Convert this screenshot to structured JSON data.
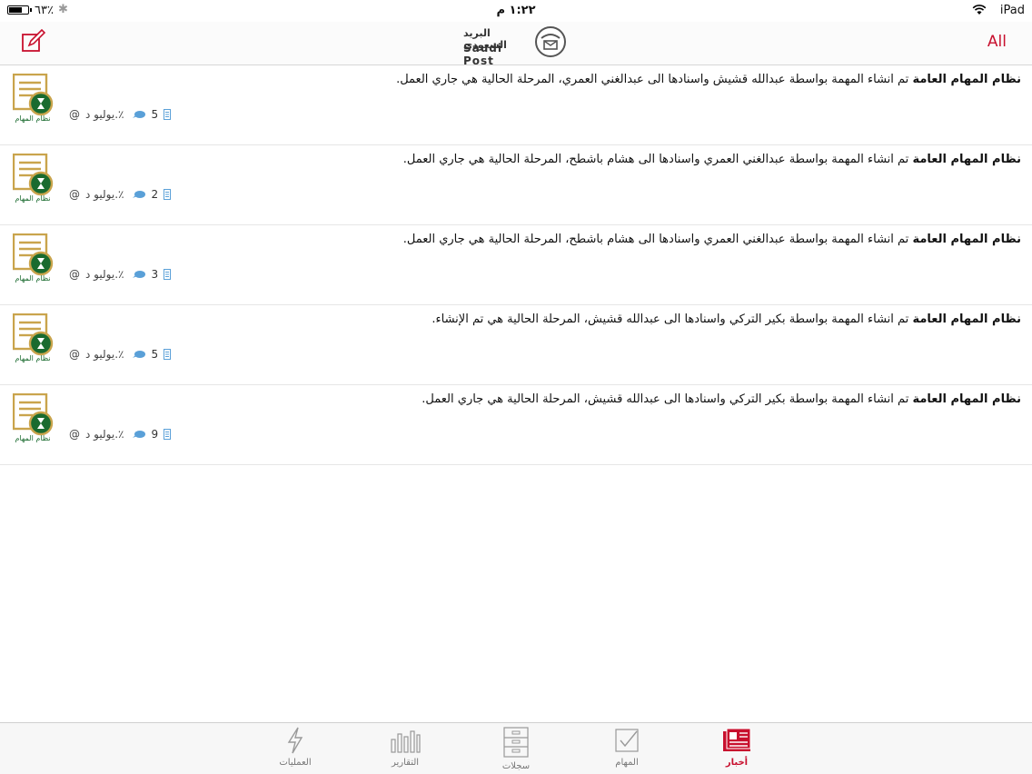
{
  "status": {
    "battery": "٦٣٪",
    "time": "١:٢٢ م",
    "device": "iPad"
  },
  "nav": {
    "all_label": "All",
    "logo_ar": "البريد السعودي",
    "logo_en": "Saudi Post"
  },
  "colors": {
    "accent": "#c8102e",
    "green": "#1a6b2f",
    "gold": "#c9a44c",
    "bubble": "#5aa0d8",
    "tag": "#5aa0d8"
  },
  "items": [
    {
      "system": "نظام المهام العامة",
      "text": "تم انشاء المهمة بواسطة عبدالله قشيش واسنادها الى عبدالغني العمري، المرحلة الحالية هي  جاري العمل.",
      "avatar_caption": "نظام المهام",
      "comments": "5",
      "date": "يوليو د.٪",
      "at": "@"
    },
    {
      "system": "نظام المهام العامة",
      "text": "تم انشاء المهمة بواسطة عبدالغني العمري واسنادها الى هشام باشطح، المرحلة الحالية هي  جاري العمل.",
      "avatar_caption": "نظام المهام",
      "comments": "2",
      "date": "يوليو د.٪",
      "at": "@"
    },
    {
      "system": "نظام المهام العامة",
      "text": "تم انشاء المهمة بواسطة عبدالغني العمري واسنادها الى هشام باشطح، المرحلة الحالية هي  جاري العمل.",
      "avatar_caption": "نظام المهام",
      "comments": "3",
      "date": "يوليو د.٪",
      "at": "@"
    },
    {
      "system": "نظام المهام العامة",
      "text": "تم انشاء المهمة بواسطة بكير التركي واسنادها الى عبدالله قشيش، المرحلة الحالية هي  تم الإنشاء.",
      "avatar_caption": "نظام المهام",
      "comments": "5",
      "date": "يوليو د.٪",
      "at": "@"
    },
    {
      "system": "نظام المهام العامة",
      "text": "تم انشاء المهمة بواسطة بكير التركي واسنادها الى عبدالله قشيش، المرحلة الحالية هي  جاري العمل.",
      "avatar_caption": "نظام المهام",
      "comments": "9",
      "date": "يوليو د.٪",
      "at": "@"
    }
  ],
  "tabs": [
    {
      "label": "العمليات",
      "icon": "bolt-icon"
    },
    {
      "label": "التقارير",
      "icon": "bar-chart-icon"
    },
    {
      "label": "سجلات",
      "icon": "cabinet-icon"
    },
    {
      "label": "المهام",
      "icon": "checkbox-icon"
    },
    {
      "label": "أخبار",
      "icon": "news-icon",
      "active": true
    }
  ]
}
